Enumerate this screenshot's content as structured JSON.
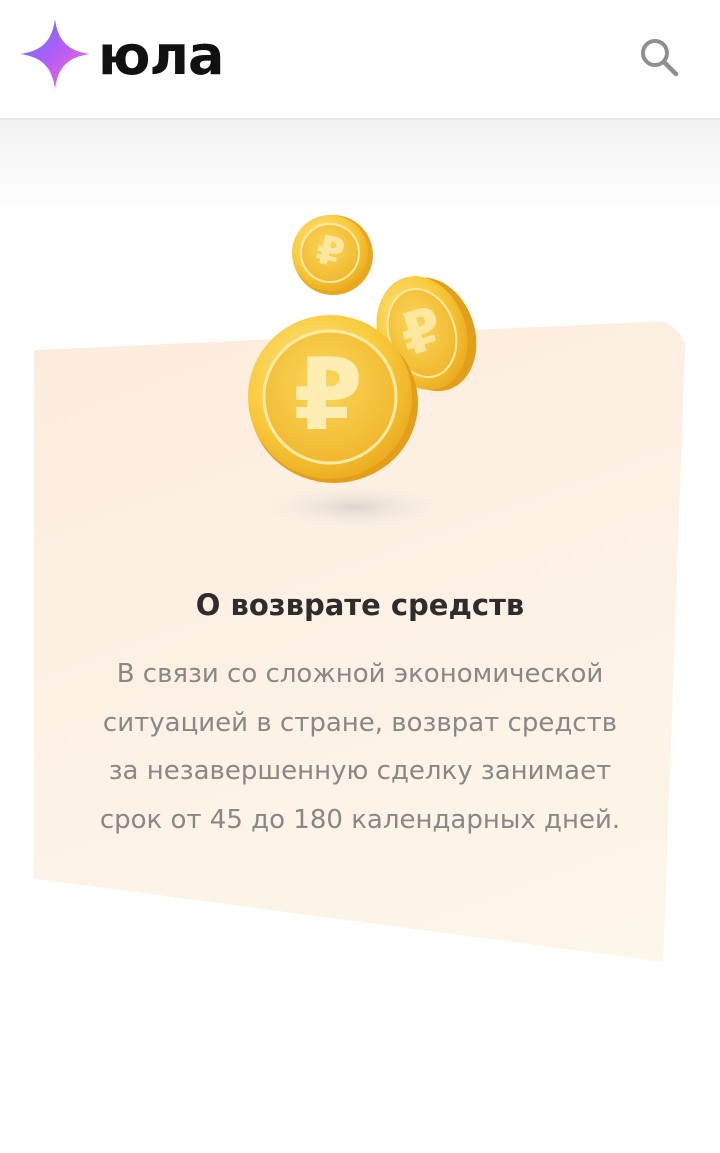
{
  "header": {
    "logo_text": "юла",
    "logo_icon": "star-sparkle-icon",
    "search_icon": "search-icon"
  },
  "notice": {
    "illustration": "ruble-coins-illustration",
    "title": "О возврате средств",
    "description_lines": [
      "В связи со сложной экономической",
      "ситуацией в стране, возврат средств",
      "за незавершенную сделку занимает",
      "срок от 45 до 180 календарных дней."
    ]
  },
  "colors": {
    "logo_gradient": [
      "#5b6cff",
      "#c45cf5",
      "#ff7ad1"
    ],
    "card_background": "#fdefe1",
    "coin_gold": "#f7c431",
    "title_text": "#2d2d2d",
    "body_text": "#8a8786"
  }
}
